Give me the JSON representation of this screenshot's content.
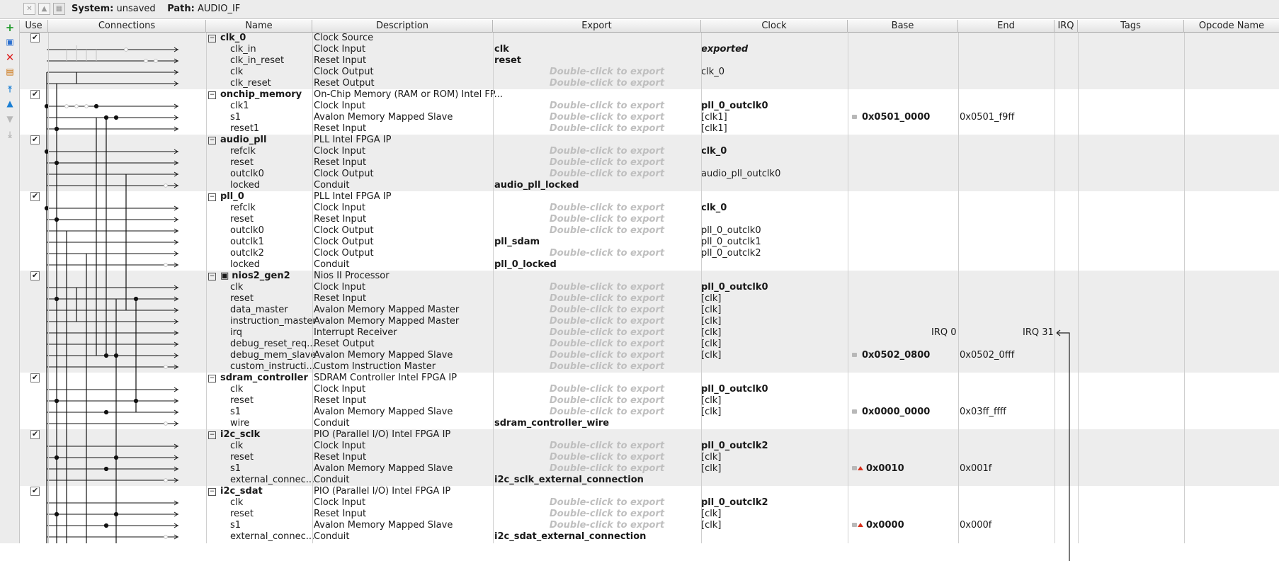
{
  "topbar": {
    "system_label": "System:",
    "system_value": "unsaved",
    "path_label": "Path:",
    "path_value": "AUDIO_IF"
  },
  "columns": [
    "Use",
    "Connections",
    "Name",
    "Description",
    "Export",
    "Clock",
    "Base",
    "End",
    "IRQ",
    "Tags",
    "Opcode Name"
  ],
  "placeholder_export": "Double-click to export",
  "rows": [
    {
      "kind": "comp",
      "name": "clk_0",
      "desc": "Clock Source",
      "export": "",
      "clock": "",
      "base": "",
      "end": "",
      "checked": true
    },
    {
      "kind": "iface",
      "name": "clk_in",
      "desc": "Clock Input",
      "export": "clk",
      "clock": "exported",
      "clock_style": "italic-bold"
    },
    {
      "kind": "iface",
      "name": "clk_in_reset",
      "desc": "Reset Input",
      "export": "reset",
      "clock": ""
    },
    {
      "kind": "iface",
      "name": "clk",
      "desc": "Clock Output",
      "export": "",
      "clock": "clk_0"
    },
    {
      "kind": "iface",
      "name": "clk_reset",
      "desc": "Reset Output",
      "export": "",
      "clock": ""
    },
    {
      "kind": "comp",
      "name": "onchip_memory",
      "desc": "On-Chip Memory (RAM or ROM) Intel FP...",
      "checked": true
    },
    {
      "kind": "iface",
      "name": "clk1",
      "desc": "Clock Input",
      "export": "",
      "clock": "pll_0_outclk0",
      "clock_style": "bold"
    },
    {
      "kind": "iface",
      "name": "s1",
      "desc": "Avalon Memory Mapped Slave",
      "export": "",
      "clock": "[clk1]",
      "base": "0x0501_0000",
      "end": "0x0501_f9ff",
      "lock": "grey"
    },
    {
      "kind": "iface",
      "name": "reset1",
      "desc": "Reset Input",
      "export": "",
      "clock": "[clk1]"
    },
    {
      "kind": "comp",
      "name": "audio_pll",
      "desc": "PLL Intel FPGA IP",
      "checked": true
    },
    {
      "kind": "iface",
      "name": "refclk",
      "desc": "Clock Input",
      "export": "",
      "clock": "clk_0",
      "clock_style": "bold"
    },
    {
      "kind": "iface",
      "name": "reset",
      "desc": "Reset Input",
      "export": "",
      "clock": ""
    },
    {
      "kind": "iface",
      "name": "outclk0",
      "desc": "Clock Output",
      "export": "",
      "clock": "audio_pll_outclk0"
    },
    {
      "kind": "iface",
      "name": "locked",
      "desc": "Conduit",
      "export": "audio_pll_locked",
      "clock": ""
    },
    {
      "kind": "comp",
      "name": "pll_0",
      "desc": "PLL Intel FPGA IP",
      "checked": true
    },
    {
      "kind": "iface",
      "name": "refclk",
      "desc": "Clock Input",
      "export": "",
      "clock": "clk_0",
      "clock_style": "bold"
    },
    {
      "kind": "iface",
      "name": "reset",
      "desc": "Reset Input",
      "export": "",
      "clock": ""
    },
    {
      "kind": "iface",
      "name": "outclk0",
      "desc": "Clock Output",
      "export": "",
      "clock": "pll_0_outclk0"
    },
    {
      "kind": "iface",
      "name": "outclk1",
      "desc": "Clock Output",
      "export": "pll_sdam",
      "clock": "pll_0_outclk1"
    },
    {
      "kind": "iface",
      "name": "outclk2",
      "desc": "Clock Output",
      "export": "",
      "clock": "pll_0_outclk2"
    },
    {
      "kind": "iface",
      "name": "locked",
      "desc": "Conduit",
      "export": "pll_0_locked",
      "clock": ""
    },
    {
      "kind": "comp",
      "name": "nios2_gen2",
      "desc": "Nios II Processor",
      "checked": true,
      "cpu": true
    },
    {
      "kind": "iface",
      "name": "clk",
      "desc": "Clock Input",
      "export": "",
      "clock": "pll_0_outclk0",
      "clock_style": "bold"
    },
    {
      "kind": "iface",
      "name": "reset",
      "desc": "Reset Input",
      "export": "",
      "clock": "[clk]"
    },
    {
      "kind": "iface",
      "name": "data_master",
      "desc": "Avalon Memory Mapped Master",
      "export": "",
      "clock": "[clk]"
    },
    {
      "kind": "iface",
      "name": "instruction_master",
      "desc": "Avalon Memory Mapped Master",
      "export": "",
      "clock": "[clk]"
    },
    {
      "kind": "iface",
      "name": "irq",
      "desc": "Interrupt Receiver",
      "export": "",
      "clock": "[clk]",
      "irq_start": "IRQ 0",
      "irq_end": "IRQ 31"
    },
    {
      "kind": "iface",
      "name": "debug_reset_req...",
      "desc": "Reset Output",
      "export": "",
      "clock": "[clk]"
    },
    {
      "kind": "iface",
      "name": "debug_mem_slave",
      "desc": "Avalon Memory Mapped Slave",
      "export": "",
      "clock": "[clk]",
      "base": "0x0502_0800",
      "end": "0x0502_0fff",
      "lock": "grey"
    },
    {
      "kind": "iface",
      "name": "custom_instructi...",
      "desc": "Custom Instruction Master",
      "export": "",
      "clock": ""
    },
    {
      "kind": "comp",
      "name": "sdram_controller",
      "desc": "SDRAM Controller Intel FPGA IP",
      "checked": true
    },
    {
      "kind": "iface",
      "name": "clk",
      "desc": "Clock Input",
      "export": "",
      "clock": "pll_0_outclk0",
      "clock_style": "bold"
    },
    {
      "kind": "iface",
      "name": "reset",
      "desc": "Reset Input",
      "export": "",
      "clock": "[clk]"
    },
    {
      "kind": "iface",
      "name": "s1",
      "desc": "Avalon Memory Mapped Slave",
      "export": "",
      "clock": "[clk]",
      "base": "0x0000_0000",
      "end": "0x03ff_ffff",
      "lock": "grey"
    },
    {
      "kind": "iface",
      "name": "wire",
      "desc": "Conduit",
      "export": "sdram_controller_wire",
      "clock": ""
    },
    {
      "kind": "comp",
      "name": "i2c_sclk",
      "desc": "PIO (Parallel I/O) Intel FPGA IP",
      "checked": true
    },
    {
      "kind": "iface",
      "name": "clk",
      "desc": "Clock Input",
      "export": "",
      "clock": "pll_0_outclk2",
      "clock_style": "bold"
    },
    {
      "kind": "iface",
      "name": "reset",
      "desc": "Reset Input",
      "export": "",
      "clock": "[clk]"
    },
    {
      "kind": "iface",
      "name": "s1",
      "desc": "Avalon Memory Mapped Slave",
      "export": "",
      "clock": "[clk]",
      "base": "0x0010",
      "end": "0x001f",
      "lock": "red"
    },
    {
      "kind": "iface",
      "name": "external_connec...",
      "desc": "Conduit",
      "export": "i2c_sclk_external_connection",
      "clock": ""
    },
    {
      "kind": "comp",
      "name": "i2c_sdat",
      "desc": "PIO (Parallel I/O) Intel FPGA IP",
      "checked": true
    },
    {
      "kind": "iface",
      "name": "clk",
      "desc": "Clock Input",
      "export": "",
      "clock": "pll_0_outclk2",
      "clock_style": "bold"
    },
    {
      "kind": "iface",
      "name": "reset",
      "desc": "Reset Input",
      "export": "",
      "clock": "[clk]"
    },
    {
      "kind": "iface",
      "name": "s1",
      "desc": "Avalon Memory Mapped Slave",
      "export": "",
      "clock": "[clk]",
      "base": "0x0000",
      "end": "0x000f",
      "lock": "red"
    },
    {
      "kind": "iface",
      "name": "external_connec...",
      "desc": "Conduit",
      "export": "i2c_sdat_external_connection",
      "clock": ""
    }
  ]
}
